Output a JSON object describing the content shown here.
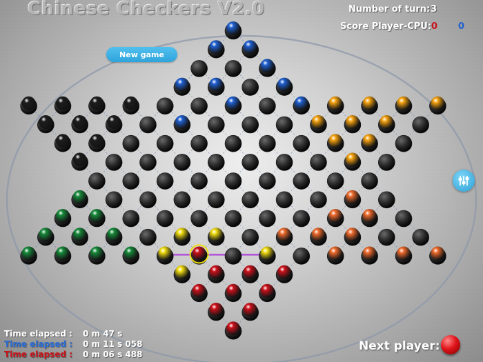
{
  "title": "Chinese Checkers V2.0",
  "turn": {
    "label": "Number of turn:",
    "value": "3"
  },
  "score": {
    "label": "Score Player-CPU:",
    "red": "0",
    "blue": "0"
  },
  "new_game_label": "New game",
  "times": [
    {
      "label": "Time elapsed :",
      "value": "0 m 47 s",
      "color": "#ffffff"
    },
    {
      "label": "Time elapsed :",
      "value": "0 m 11 s 058",
      "color": "#2b6fd8"
    },
    {
      "label": "Time elapsed :",
      "value": "0 m 06 s 488",
      "color": "#c8141a"
    }
  ],
  "next_player_label": "Next player:",
  "next_player_color": "red",
  "colors": {
    "blue": "#1f5fd0",
    "black": "#1c1c1c",
    "orange": "#f5a20f",
    "coral": "#ee6a2c",
    "green": "#168a3a",
    "red": "#cc101a",
    "yellow": "#f0dc10",
    "empty": "#2a2a2a"
  },
  "board": {
    "pieces": {
      "blue": [
        [
          0,
          0
        ],
        [
          1,
          0
        ],
        [
          1,
          1
        ],
        [
          2,
          2
        ],
        [
          3,
          0
        ],
        [
          3,
          1
        ],
        [
          3,
          3
        ],
        [
          4,
          6
        ],
        [
          4,
          8
        ],
        [
          5,
          4
        ]
      ],
      "black": [
        [
          4,
          0
        ],
        [
          4,
          1
        ],
        [
          4,
          2
        ],
        [
          4,
          3
        ],
        [
          5,
          0
        ],
        [
          5,
          1
        ],
        [
          5,
          2
        ],
        [
          6,
          0
        ],
        [
          6,
          1
        ],
        [
          7,
          0
        ]
      ],
      "orange": [
        [
          4,
          9
        ],
        [
          4,
          10
        ],
        [
          4,
          11
        ],
        [
          4,
          12
        ],
        [
          5,
          8
        ],
        [
          5,
          9
        ],
        [
          5,
          10
        ],
        [
          6,
          8
        ],
        [
          6,
          9
        ],
        [
          7,
          8
        ]
      ],
      "coral": [
        [
          9,
          8
        ],
        [
          10,
          8
        ],
        [
          10,
          9
        ],
        [
          11,
          7
        ],
        [
          11,
          8
        ],
        [
          11,
          9
        ],
        [
          12,
          9
        ],
        [
          12,
          10
        ],
        [
          12,
          11
        ],
        [
          12,
          12
        ]
      ],
      "green": [
        [
          9,
          0
        ],
        [
          10,
          0
        ],
        [
          10,
          1
        ],
        [
          11,
          0
        ],
        [
          11,
          1
        ],
        [
          11,
          2
        ],
        [
          12,
          0
        ],
        [
          12,
          1
        ],
        [
          12,
          2
        ],
        [
          12,
          3
        ]
      ],
      "red": [
        [
          12,
          5
        ],
        [
          13,
          1
        ],
        [
          13,
          2
        ],
        [
          13,
          3
        ],
        [
          14,
          0
        ],
        [
          14,
          1
        ],
        [
          14,
          2
        ],
        [
          15,
          0
        ],
        [
          15,
          1
        ],
        [
          16,
          0
        ]
      ],
      "yellow": [
        [
          11,
          4
        ],
        [
          11,
          5
        ],
        [
          12,
          4
        ],
        [
          12,
          7
        ],
        [
          13,
          0
        ]
      ],
      "red_ring": [
        [
          12,
          5
        ]
      ]
    },
    "move_line": {
      "from": [
        12,
        4
      ],
      "to": [
        12,
        7
      ]
    }
  }
}
